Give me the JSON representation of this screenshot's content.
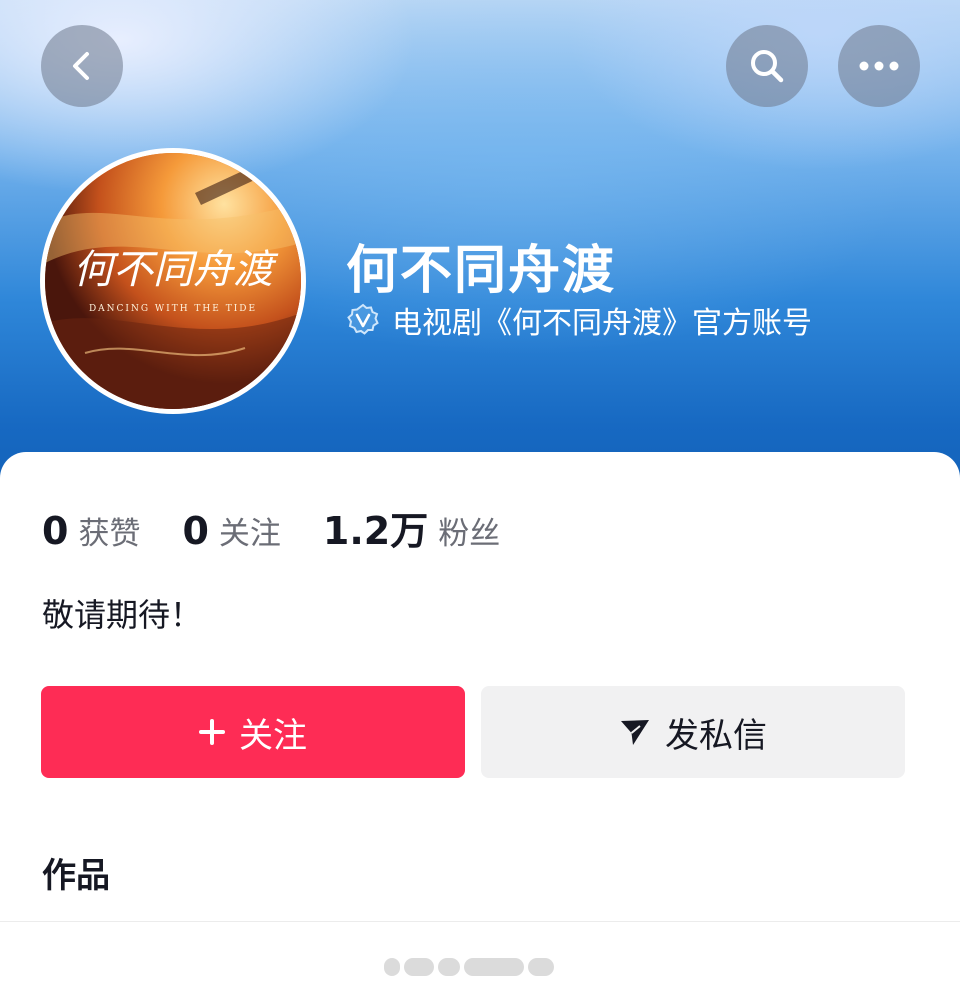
{
  "header": {
    "back_icon": "chevron-left-icon",
    "search_icon": "search-icon",
    "more_icon": "more-horizontal-icon"
  },
  "profile": {
    "name": "何不同舟渡",
    "verification_icon": "verified-badge-icon",
    "verification_text": "电视剧《何不同舟渡》官方账号",
    "avatar_title": "何不同舟渡",
    "avatar_subtitle": "DANCING WITH THE TIDE"
  },
  "stats": [
    {
      "value": "0",
      "label": "获赞"
    },
    {
      "value": "0",
      "label": "关注"
    },
    {
      "value": "1.2万",
      "label": "粉丝"
    }
  ],
  "bio": "敬请期待！",
  "actions": {
    "follow_icon": "plus-icon",
    "follow_label": "关注",
    "message_icon": "send-icon",
    "message_label": "发私信"
  },
  "works": {
    "title": "作品"
  },
  "colors": {
    "follow_button": "#fe2c55",
    "message_button": "#f1f1f2",
    "header_blue": "#1769c2"
  }
}
